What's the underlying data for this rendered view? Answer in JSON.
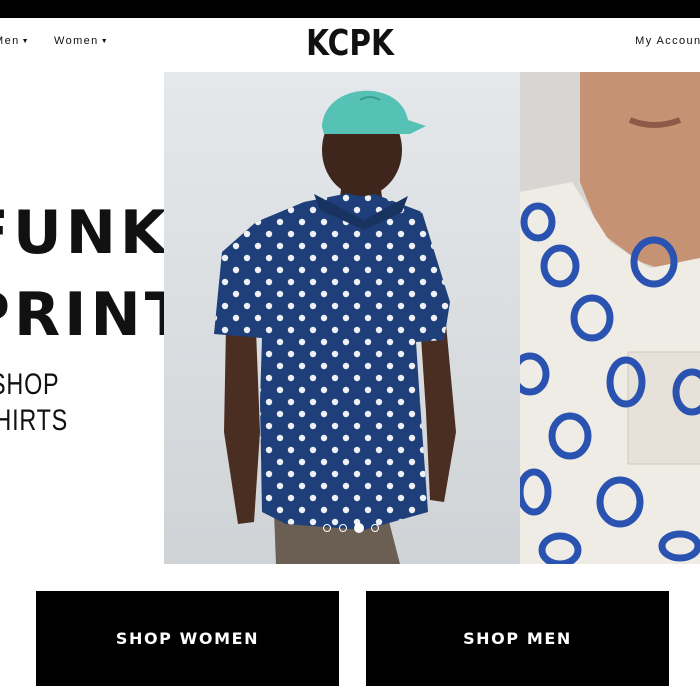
{
  "nav": {
    "men_label": "Men",
    "women_label": "Women",
    "logo": "KCPK",
    "account_label": "My Account"
  },
  "hero": {
    "promo": {
      "line1": "FUNKY",
      "line2": "PRINTS",
      "line3": "SHOP",
      "line4": "SHIRTS"
    },
    "carousel": {
      "slide_count": 4,
      "active_index": 2
    }
  },
  "cta": {
    "women_label": "SHOP WOMEN",
    "men_label": "SHOP MEN"
  },
  "colors": {
    "black": "#000000",
    "white": "#ffffff",
    "shirt_blue": "#1f3f7a",
    "cap_teal": "#56c2b6"
  },
  "icons": [
    "chevron-down-icon"
  ]
}
